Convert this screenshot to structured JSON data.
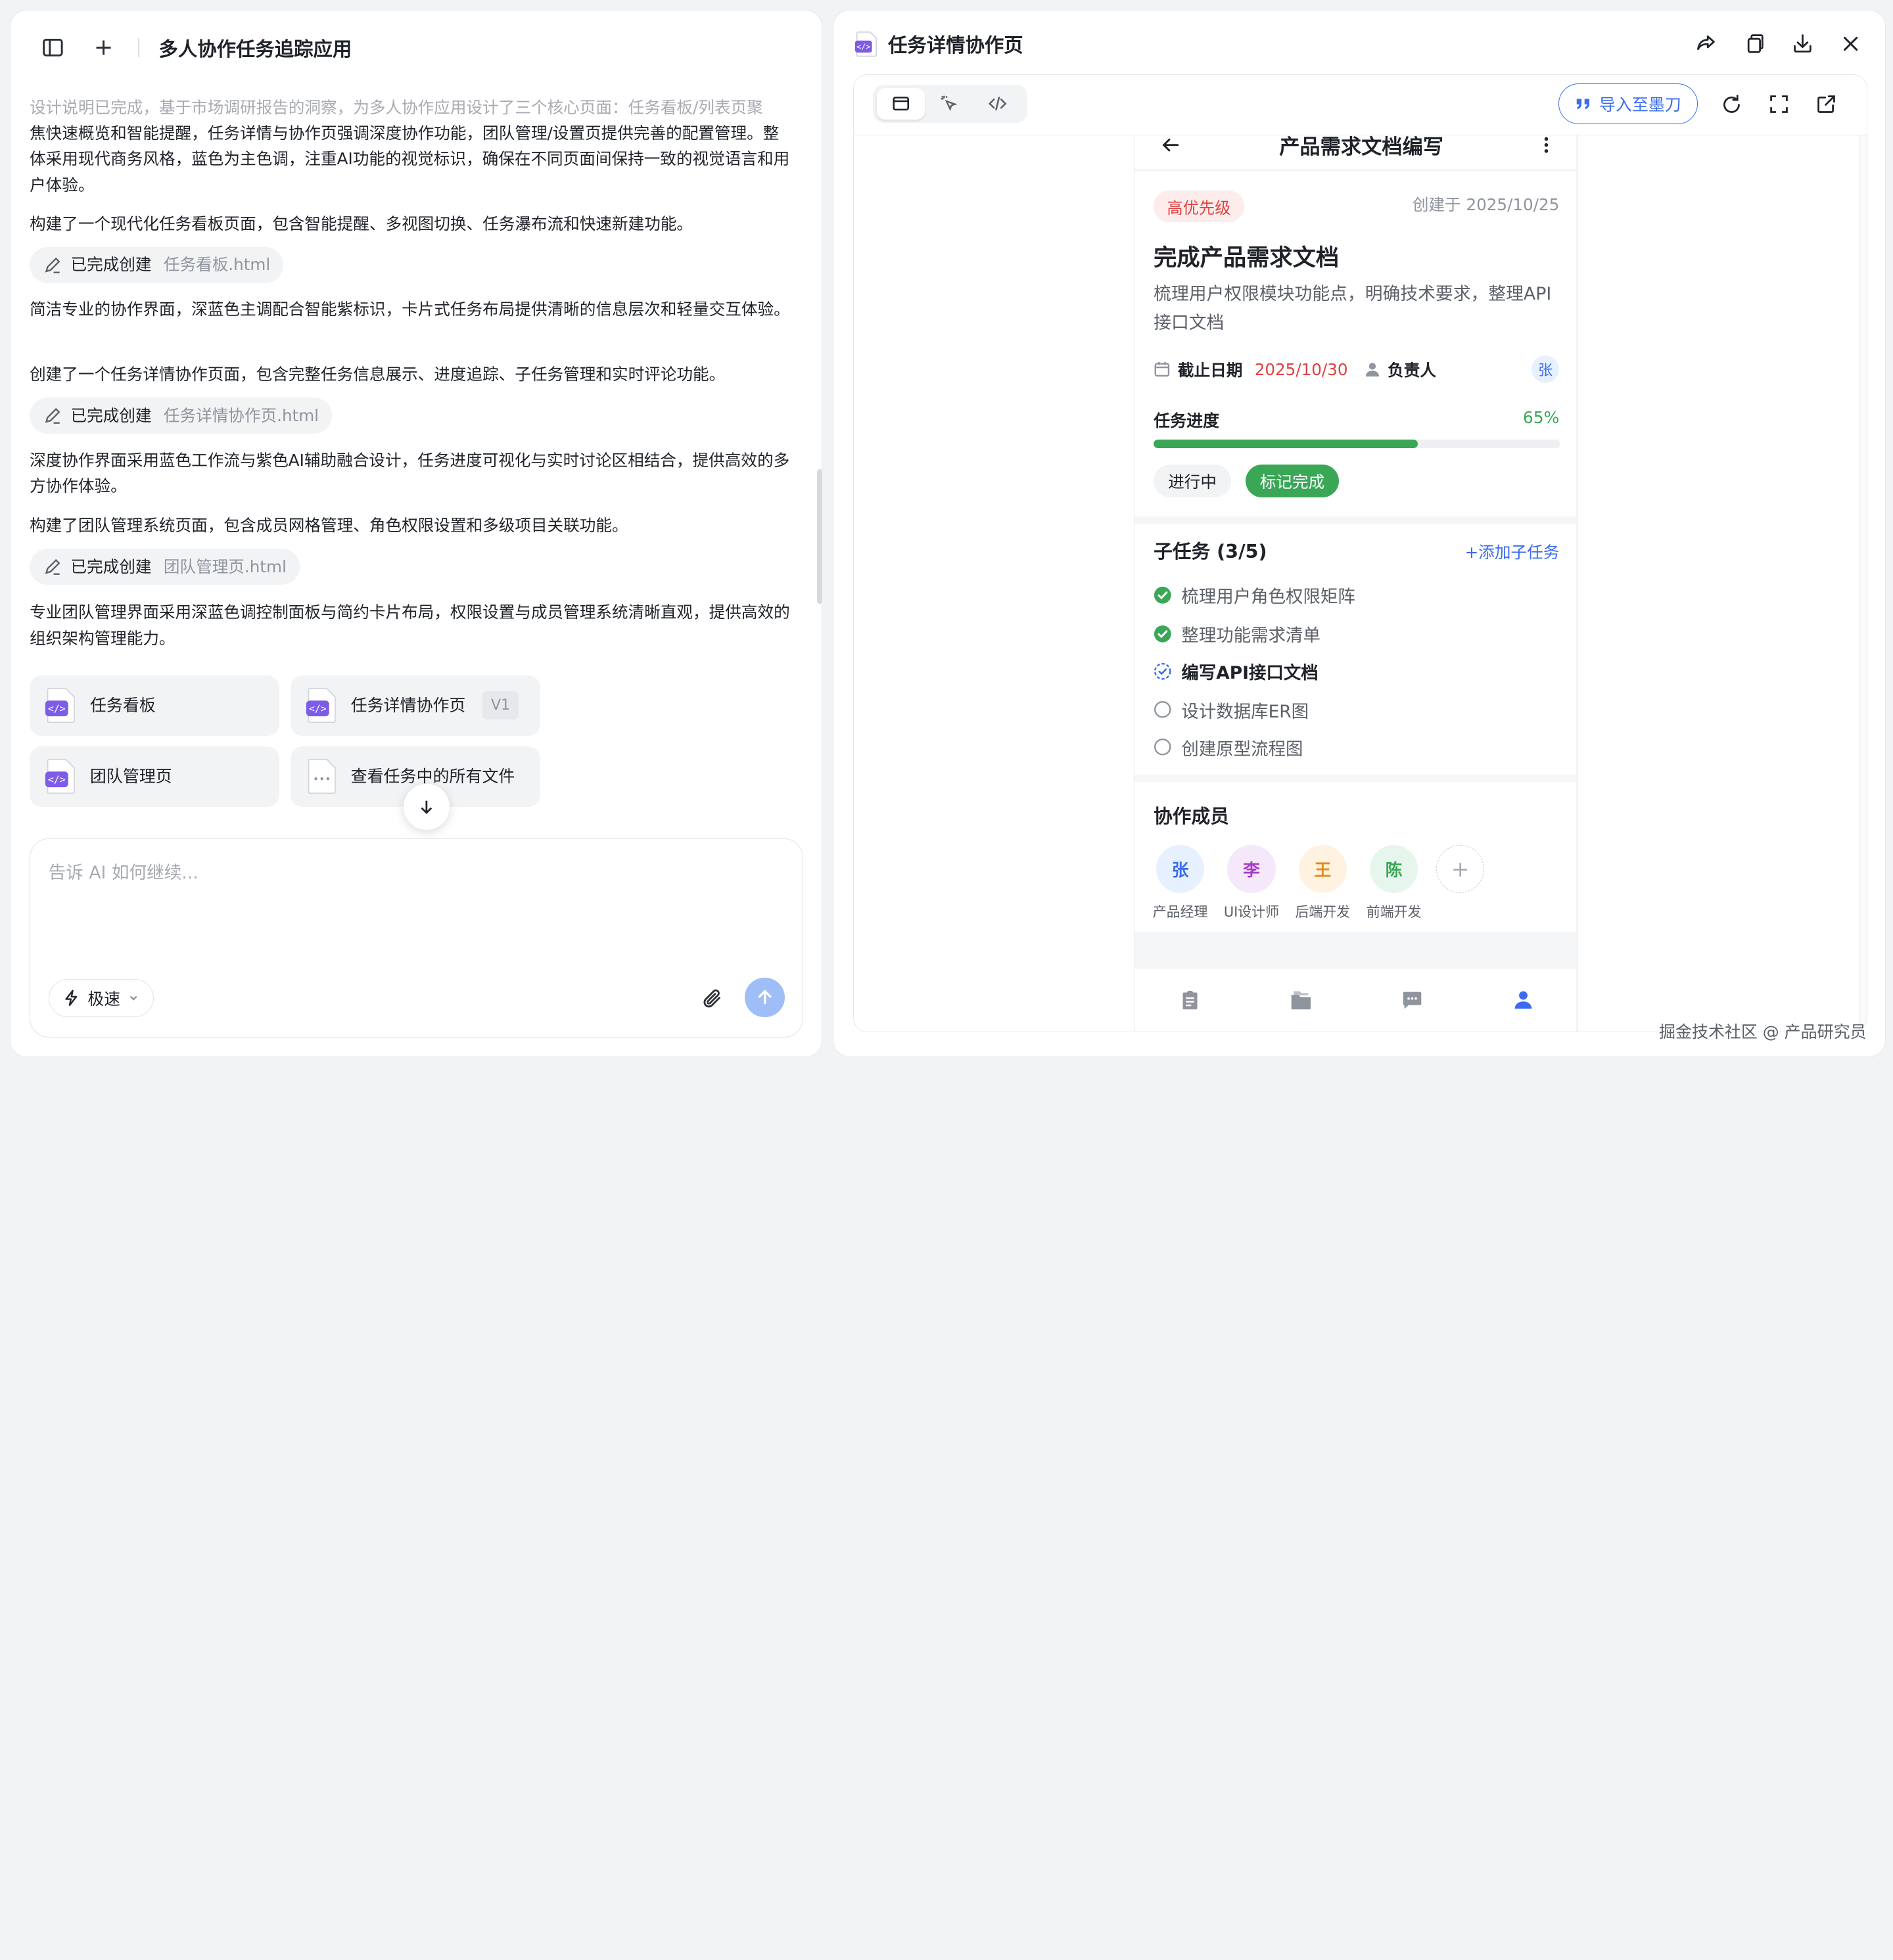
{
  "left": {
    "title": "多人协作任务追踪应用",
    "chat": [
      {
        "type": "text",
        "faded": true,
        "text": "设计说明已完成，基于市场调研报告的洞察，为多人协作应用设计了三个核心页面：任务看板/列表页聚"
      },
      {
        "type": "text",
        "text": "焦快速概览和智能提醒，任务详情与协作页强调深度协作功能，团队管理/设置页提供完善的配置管理。整体采用现代商务风格，蓝色为主色调，注重AI功能的视觉标识，确保在不同页面间保持一致的视觉语言和用户体验。"
      },
      {
        "type": "text",
        "text": "构建了一个现代化任务看板页面，包含智能提醒、多视图切换、任务瀑布流和快速新建功能。"
      },
      {
        "type": "pill",
        "label": "已完成创建",
        "file": "任务看板.html"
      },
      {
        "type": "text",
        "text": "简洁专业的协作界面，深蓝色主调配合智能紫标识，卡片式任务布局提供清晰的信息层次和轻量交互体验。"
      },
      {
        "type": "text",
        "text": "创建了一个任务详情协作页面，包含完整任务信息展示、进度追踪、子任务管理和实时评论功能。"
      },
      {
        "type": "pill",
        "label": "已完成创建",
        "file": "任务详情协作页.html"
      },
      {
        "type": "text",
        "text": "深度协作界面采用蓝色工作流与紫色AI辅助融合设计，任务进度可视化与实时讨论区相结合，提供高效的多方协作体验。"
      },
      {
        "type": "text",
        "text": "构建了团队管理系统页面，包含成员网格管理、角色权限设置和多级项目关联功能。"
      },
      {
        "type": "pill",
        "label": "已完成创建",
        "file": "团队管理页.html"
      },
      {
        "type": "text",
        "text": "专业团队管理界面采用深蓝色调控制面板与简约卡片布局，权限设置与成员管理系统清晰直观，提供高效的组织架构管理能力。"
      }
    ],
    "files": [
      {
        "label": "任务看板",
        "version": ""
      },
      {
        "label": "任务详情协作页",
        "version": "V1"
      },
      {
        "label": "团队管理页",
        "version": ""
      },
      {
        "label": "查看任务中的所有文件",
        "version": ""
      }
    ],
    "input_placeholder": "告诉 AI 如何继续...",
    "speed_label": "极速"
  },
  "right": {
    "title": "任务详情协作页",
    "import_label": "导入至墨刀",
    "phone": {
      "header_title": "产品需求文档编写",
      "priority": "高优先级",
      "created": "创建于 2025/10/25",
      "task_title": "完成产品需求文档",
      "task_desc": "梳理用户权限模块功能点，明确技术要求，整理API接口文档",
      "due_label": "截止日期",
      "due_date": "2025/10/30",
      "owner_label": "负责人",
      "owner_avatar": "张",
      "progress_label": "任务进度",
      "progress_value": "65%",
      "progress_fraction": 0.65,
      "status": "进行中",
      "done_button": "标记完成",
      "subtasks_title": "子任务 (3/5)",
      "add_subtask": "+添加子任务",
      "subtasks": [
        {
          "text": "梳理用户角色权限矩阵",
          "state": "done"
        },
        {
          "text": "整理功能需求清单",
          "state": "done"
        },
        {
          "text": "编写API接口文档",
          "state": "in-progress"
        },
        {
          "text": "设计数据库ER图",
          "state": "todo"
        },
        {
          "text": "创建原型流程图",
          "state": "todo"
        }
      ],
      "members_title": "协作成员",
      "members": [
        {
          "name": "张",
          "role": "产品经理",
          "bg": "#e6f0ff",
          "fg": "#3b6cf0"
        },
        {
          "name": "李",
          "role": "UI设计师",
          "bg": "#f5e8fb",
          "fg": "#a43fc6"
        },
        {
          "name": "王",
          "role": "后端开发",
          "bg": "#fff2e0",
          "fg": "#e38a1c"
        },
        {
          "name": "陈",
          "role": "前端开发",
          "bg": "#e6f6ec",
          "fg": "#3aa757"
        }
      ],
      "add_member": "+"
    }
  },
  "watermark": "掘金技术社区 @ 产品研究员",
  "colors": {
    "accent": "#3b6cf0",
    "success": "#3aa757",
    "danger": "#e0413f"
  }
}
